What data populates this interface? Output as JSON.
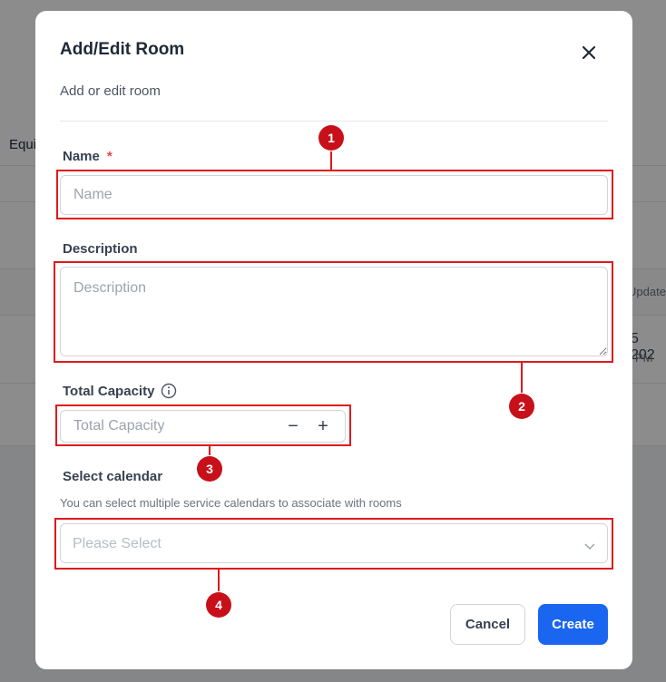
{
  "background": {
    "col_equi": "Equi",
    "col_update": "Update",
    "date_frag": "5 202",
    "pm_frag": "PM"
  },
  "modal": {
    "title": "Add/Edit Room",
    "subtitle": "Add or edit room",
    "close_icon": "close-icon"
  },
  "form": {
    "name": {
      "label": "Name",
      "required_mark": "*",
      "placeholder": "Name",
      "value": ""
    },
    "description": {
      "label": "Description",
      "placeholder": "Description",
      "value": ""
    },
    "capacity": {
      "label": "Total Capacity",
      "info_icon": "info-icon",
      "placeholder": "Total Capacity",
      "value": "",
      "minus": "−",
      "plus": "+"
    },
    "calendar": {
      "label": "Select calendar",
      "helper": "You can select multiple service calendars to associate with rooms",
      "placeholder": "Please Select"
    }
  },
  "footer": {
    "cancel_label": "Cancel",
    "create_label": "Create"
  },
  "annotations": [
    "1",
    "2",
    "3",
    "4"
  ],
  "colors": {
    "annotation": "#e0191c",
    "primary": "#1a66f0"
  }
}
